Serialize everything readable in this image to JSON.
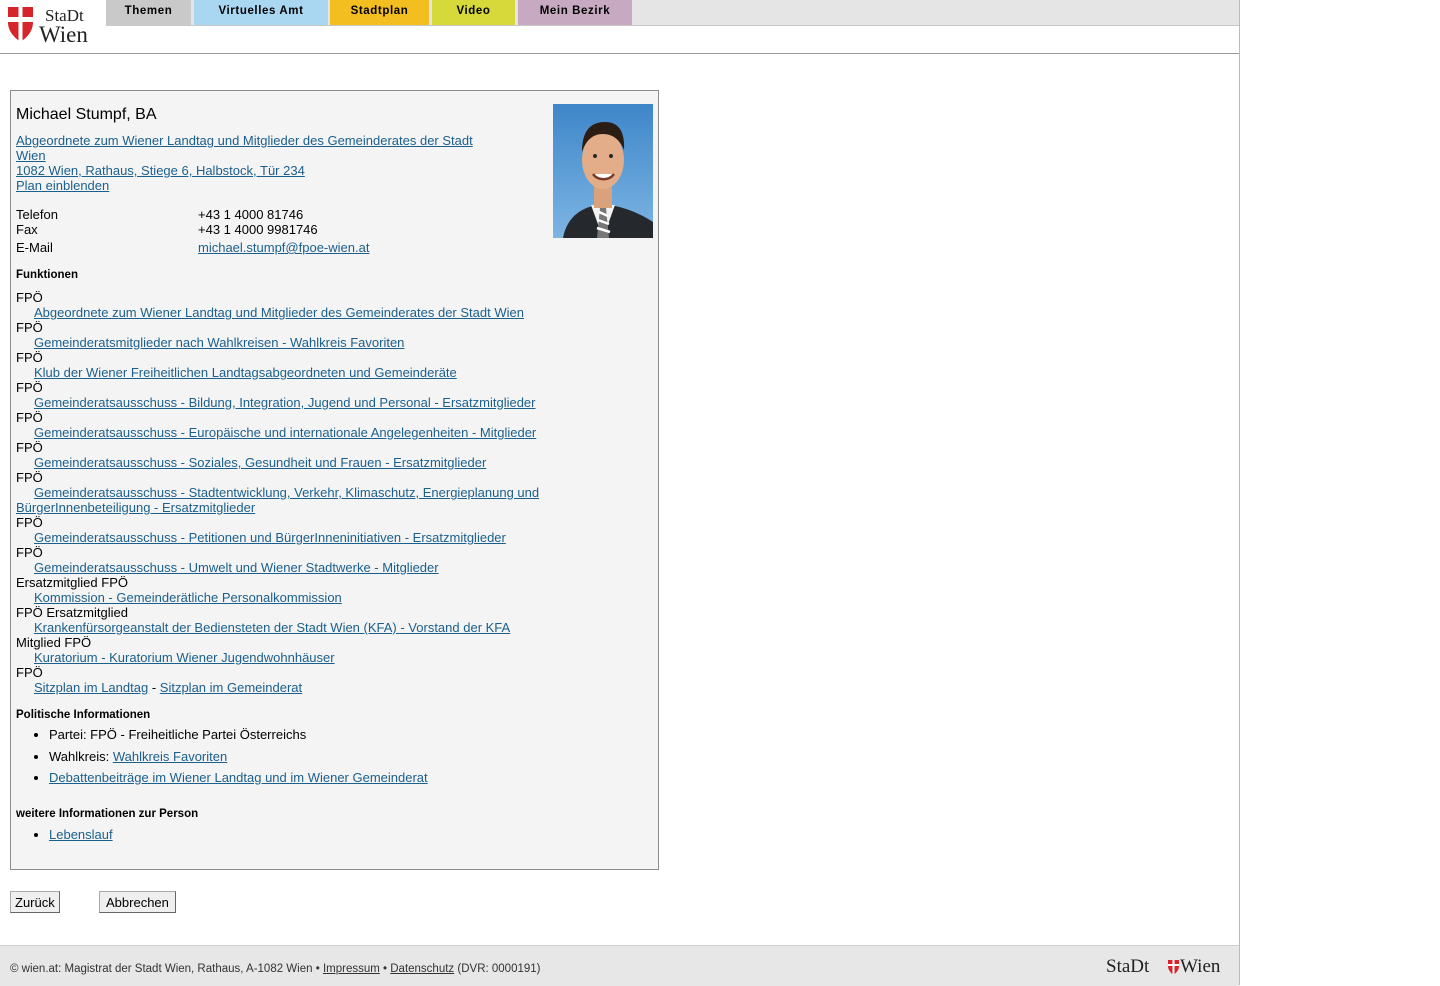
{
  "header": {
    "logo_text_top": "StaDt",
    "logo_text_bottom": "Wien",
    "nav": [
      {
        "label": "Themen",
        "color": "#c9c9c9"
      },
      {
        "label": "Virtuelles Amt",
        "color": "#a9d6f0"
      },
      {
        "label": "Stadtplan",
        "color": "#f3be1f"
      },
      {
        "label": "Video",
        "color": "#d7d83a"
      },
      {
        "label": "Mein Bezirk",
        "color": "#c7a9c1"
      }
    ]
  },
  "person": {
    "name": "Michael Stumpf, BA",
    "role_line1": "Abgeordnete zum Wiener Landtag und Mitglieder des Gemeinderates der Stadt",
    "role_line2": "Wien",
    "address": "1082 Wien, Rathaus, Stiege 6, Halbstock, Tür 234",
    "map_link": "Plan einblenden",
    "contact": {
      "telefon_label": "Telefon",
      "telefon": "+43 1 4000 81746",
      "fax_label": "Fax",
      "fax": "+43 1 4000 9981746",
      "email_label": "E-Mail",
      "email": "michael.stumpf@fpoe-wien.at"
    }
  },
  "funktionen": {
    "heading": "Funktionen",
    "items": [
      {
        "org": "FPÖ",
        "body": "Abgeordnete zum Wiener Landtag und Mitglieder des Gemeinderates der Stadt Wien"
      },
      {
        "org": "FPÖ",
        "body": "Gemeinderatsmitglieder nach Wahlkreisen - Wahlkreis Favoriten"
      },
      {
        "org": "FPÖ",
        "body": "Klub der Wiener Freiheitlichen Landtagsabgeordneten und Gemeinderäte"
      },
      {
        "org": "FPÖ",
        "body": "Gemeinderatsausschuss - Bildung, Integration, Jugend und Personal - Ersatzmitglieder"
      },
      {
        "org": "FPÖ",
        "body": "Gemeinderatsausschuss - Europäische und internationale Angelegenheiten - Mitglieder"
      },
      {
        "org": "FPÖ",
        "body": "Gemeinderatsausschuss - Soziales, Gesundheit und Frauen - Ersatzmitglieder"
      },
      {
        "org": "FPÖ",
        "body": "Gemeinderatsausschuss - Stadtentwicklung, Verkehr, Klimaschutz, Energieplanung und BürgerInnenbeteiligung - Ersatzmitglieder"
      },
      {
        "org": "FPÖ",
        "body": "Gemeinderatsausschuss - Petitionen und BürgerInneninitiativen - Ersatzmitglieder"
      },
      {
        "org": "FPÖ",
        "body": "Gemeinderatsausschuss - Umwelt und Wiener Stadtwerke - Mitglieder"
      },
      {
        "org": "Ersatzmitglied FPÖ",
        "body": "Kommission - Gemeinderätliche Personalkommission"
      },
      {
        "org": "FPÖ Ersatzmitglied",
        "body": "Krankenfürsorgeanstalt der Bediensteten der Stadt Wien (KFA) - Vorstand der KFA"
      },
      {
        "org": "Mitglied FPÖ",
        "body": "Kuratorium - Kuratorium Wiener Jugendwohnhäuser"
      }
    ],
    "last_org": "FPÖ",
    "sitzplan_landtag": "Sitzplan im Landtag",
    "sitzplan_sep": "-",
    "sitzplan_gemeinderat": "Sitzplan im Gemeinderat"
  },
  "politisch": {
    "heading": "Politische Informationen",
    "partei": "Partei: FPÖ - Freiheitliche Partei Österreichs",
    "wahlkreis_label": "Wahlkreis:",
    "wahlkreis": "Wahlkreis Favoriten",
    "debatten": "Debattenbeiträge im Wiener Landtag und im Wiener Gemeinderat"
  },
  "weitere": {
    "heading": "weitere Informationen zur Person",
    "lebenslauf": "Lebenslauf"
  },
  "buttons": {
    "back": "Zurück",
    "cancel": "Abbrechen"
  },
  "footer": {
    "copyright": "© wien.at: Magistrat der Stadt Wien, Rathaus, A-1082 Wien •",
    "impressum": "Impressum",
    "bullet": "•",
    "datenschutz": "Datenschutz",
    "dvr": "(DVR: 0000191)",
    "logo_left": "StaDt",
    "logo_right": "Wien"
  },
  "colors": {
    "link": "#1b5f8c",
    "wien_red": "#d6242b"
  }
}
